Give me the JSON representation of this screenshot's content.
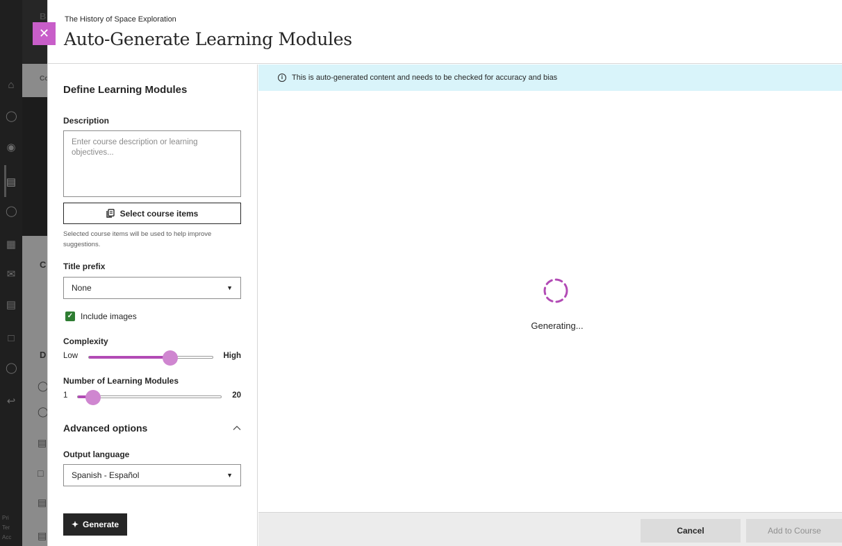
{
  "course_name": "The History of Space Exploration",
  "modal_title": "Auto-Generate Learning Modules",
  "background_app": {
    "nav_icons": [
      "institution-icon",
      "person-icon",
      "globe-icon",
      "courses-icon",
      "groups-icon",
      "calendar-icon",
      "messages-icon",
      "grades-icon",
      "tools-icon",
      "profile-icon",
      "sign-out-icon"
    ],
    "footer_lines": [
      "Pri",
      "Ter",
      "Acc"
    ],
    "strip_letters": [
      "B",
      "Co",
      "C",
      "D"
    ]
  },
  "form": {
    "section_title": "Define Learning Modules",
    "description": {
      "label": "Description",
      "placeholder": "Enter course description or learning objectives...",
      "value": ""
    },
    "select_course_items_label": "Select course items",
    "helper_text": "Selected course items will be used to help improve suggestions.",
    "title_prefix": {
      "label": "Title prefix",
      "selected": "None"
    },
    "include_images": {
      "label": "Include images",
      "checked": true
    },
    "complexity": {
      "label": "Complexity",
      "min_label": "Low",
      "max_label": "High",
      "value_fraction": 0.66
    },
    "module_count": {
      "label": "Number of Learning Modules",
      "min_label": "1",
      "max_label": "20",
      "value": 3
    },
    "advanced_options": {
      "title": "Advanced options",
      "expanded": true
    },
    "output_language": {
      "label": "Output language",
      "selected": "Spanish - Español"
    },
    "generate_label": "Generate"
  },
  "preview": {
    "banner_text": "This is auto-generated content and needs to be checked for accuracy and bias",
    "status_text": "Generating..."
  },
  "footer": {
    "cancel_label": "Cancel",
    "add_label": "Add to Course"
  },
  "colors": {
    "accent": "#c85ec9",
    "slider_fill": "#b24bb5",
    "slider_thumb": "#cf86d0",
    "checkbox": "#2e7d32",
    "banner_bg": "#d9f4fa"
  }
}
